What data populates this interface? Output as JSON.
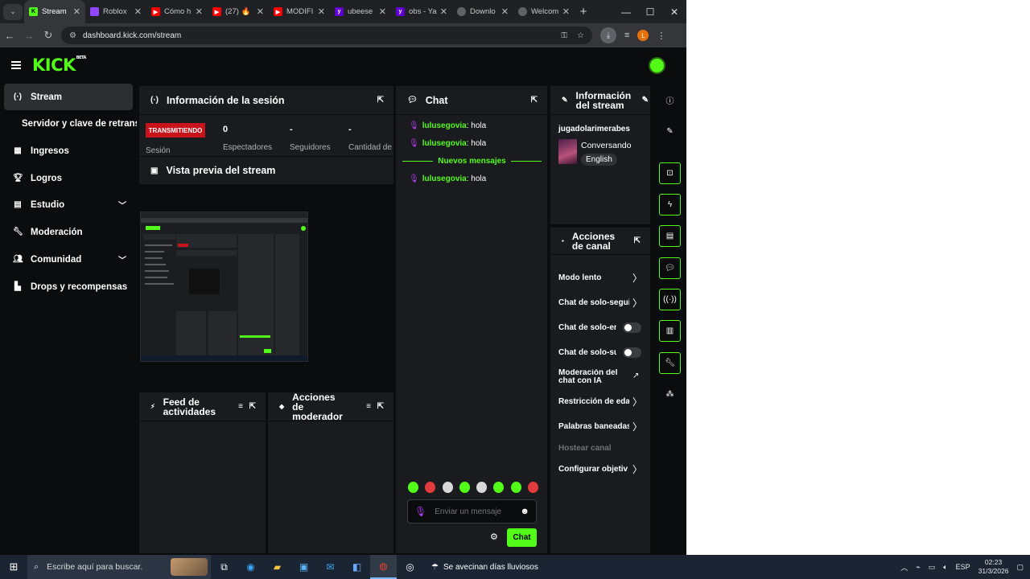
{
  "browser": {
    "tabs": [
      {
        "title": "Stream",
        "icon": "kick-favicon",
        "color": "#53fc18",
        "active": true
      },
      {
        "title": "Roblox",
        "icon": "twitch-favicon",
        "color": "#9146ff"
      },
      {
        "title": "Cómo h",
        "icon": "youtube-favicon",
        "color": "#ff0000"
      },
      {
        "title": "(27) 🔥",
        "icon": "youtube-favicon",
        "color": "#ff0000"
      },
      {
        "title": "MODIFI",
        "icon": "youtube-favicon",
        "color": "#ff0000"
      },
      {
        "title": "ubeese",
        "icon": "yahoo-favicon",
        "color": "#6001d2"
      },
      {
        "title": "obs - Ya",
        "icon": "yahoo-favicon",
        "color": "#6001d2"
      },
      {
        "title": "Downlo",
        "icon": "globe-favicon",
        "color": "#5f6368"
      },
      {
        "title": "Welcom",
        "icon": "globe-favicon",
        "color": "#5f6368"
      }
    ],
    "url": "dashboard.kick.com/stream",
    "profile_initial": "L"
  },
  "brand": {
    "logo": "KICK",
    "beta": "BETA",
    "accent": "#53fc18"
  },
  "sidebar": {
    "items": [
      {
        "label": "Stream",
        "icon": "broadcast-icon"
      },
      {
        "label": "Servidor y clave de retransmisión"
      },
      {
        "label": "Ingresos",
        "icon": "chart-icon"
      },
      {
        "label": "Logros",
        "icon": "trophy-icon"
      },
      {
        "label": "Estudio",
        "icon": "studio-icon"
      },
      {
        "label": "Moderación",
        "icon": "wrench-icon"
      },
      {
        "label": "Comunidad",
        "icon": "people-icon"
      },
      {
        "label": "Drops y recompensas",
        "icon": "gift-icon"
      }
    ]
  },
  "session": {
    "title": "Información de la sesión",
    "status": "TRANSMITIENDO",
    "session_label": "Sesión",
    "stats": [
      {
        "value": "0",
        "label": "Espectadores"
      },
      {
        "value": "-",
        "label": "Seguidores"
      },
      {
        "value": "-",
        "label": "Cantidad de"
      }
    ]
  },
  "preview": {
    "title": "Vista previa del stream"
  },
  "feed": {
    "title": "Feed de actividades"
  },
  "modactions": {
    "title": "Acciones de moderador"
  },
  "chat": {
    "title": "Chat",
    "messages": [
      {
        "user": "lulusegovia",
        "text": "hola"
      },
      {
        "user": "lulusegovia",
        "text": "hola"
      },
      {
        "user": "lulusegovia",
        "text": "hola"
      }
    ],
    "new_messages": "Nuevos mensajes",
    "placeholder": "Enviar un mensaje",
    "send_label": "Chat"
  },
  "stream_info": {
    "title": "Información del stream",
    "username": "jugadolarimerabes",
    "category": "Conversando",
    "language": "English"
  },
  "channel_actions": {
    "title": "Acciones de canal",
    "items": [
      {
        "label": "Modo lento",
        "control": "chevron"
      },
      {
        "label": "Chat de solo-seguidores",
        "control": "chevron"
      },
      {
        "label": "Chat de solo-emotes",
        "control": "toggle"
      },
      {
        "label": "Chat de solo-suscriptores",
        "control": "toggle"
      },
      {
        "label": "Moderación del chat con IA",
        "control": "external"
      },
      {
        "label": "Restricción de edad",
        "control": "chevron"
      },
      {
        "label": "Palabras baneadas",
        "control": "chevron"
      },
      {
        "label": "Hostear canal",
        "control": "none",
        "disabled": true
      },
      {
        "label": "Configurar objetivos",
        "control": "chevron"
      }
    ]
  },
  "taskbar": {
    "search_placeholder": "Escribe aquí para buscar.",
    "weather": "Se avecinan días lluviosos",
    "language": "ESP",
    "time": "02:23",
    "date": "31/3/2026"
  }
}
